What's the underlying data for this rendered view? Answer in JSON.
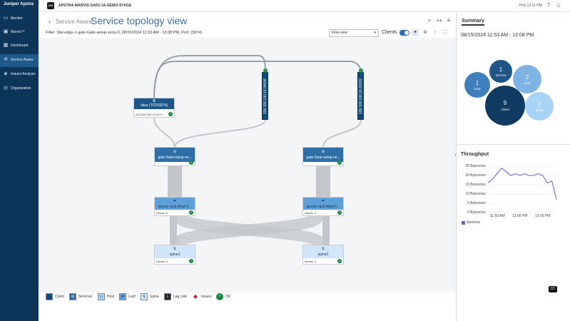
{
  "topbar": {
    "logo": "Juniper Apstra",
    "org_badge": "MM",
    "org_name": "APSTRA-MARVIS-SADC-IA-DEMO-STAGE",
    "time": "THU 12:11 PM"
  },
  "sidebar": {
    "items": [
      {
        "label": "Monitor",
        "icon": "monitor-icon"
      },
      {
        "label": "Marvis™",
        "icon": "marvis-icon"
      },
      {
        "label": "Dashboard",
        "icon": "dashboard-icon"
      },
      {
        "label": "Service Aware",
        "icon": "service-aware-icon",
        "active": true
      },
      {
        "label": "Impact Analysis",
        "icon": "impact-analysis-icon"
      },
      {
        "label": "Organization",
        "icon": "organization-icon"
      }
    ]
  },
  "header": {
    "breadcrumb": "Service Aware",
    "title": "Service topology view",
    "filter": "Filter: Site:edge-1-gate-Gate-setup-venu-0, 08/15/2024 11:53 AM - 12:08 PM, Port: (3074)"
  },
  "toolbar": {
    "view_select": "Flow view",
    "clients_label": "Clients",
    "clients_on": true
  },
  "topology": {
    "xbox": {
      "icon": "⌘",
      "label": "xbox (TCP/3074)",
      "address": "200.200.200.10:3074"
    },
    "links": [
      {
        "label": "100.100.100.16:34646"
      },
      {
        "label": "100.100.100.16:33192"
      }
    ],
    "services": [
      {
        "label": "gate-Gate-setup-ve..."
      },
      {
        "label": "gate-Gate-setup-ve..."
      }
    ],
    "leafs": [
      {
        "label": "vjunos-rack-4leaf-0...",
        "issues": "Issues: 0"
      },
      {
        "label": "vjunos-rack-4leaf-0...",
        "issues": "Issues: 0"
      }
    ],
    "spines": [
      {
        "label": "spine1",
        "issues": "Issues: 0"
      },
      {
        "label": "spine2",
        "issues": "Issues: 0"
      }
    ]
  },
  "legend": [
    {
      "label": "Client",
      "color": "#0f4a7a",
      "glyph": ""
    },
    {
      "label": "Services",
      "color": "#2f6fa7",
      "glyph": "⚙"
    },
    {
      "label": "Host",
      "color": "#a9d0f5",
      "glyph": "▭"
    },
    {
      "label": "Leaf",
      "color": "#5fa0d8",
      "glyph": "⇄"
    },
    {
      "label": "Spine",
      "color": "#cfe6fb",
      "glyph": "⇅"
    },
    {
      "label": "Lag Link",
      "color": "#222222",
      "glyph": "L"
    },
    {
      "label": "Issues",
      "color": "#c62828",
      "glyph": "◆"
    },
    {
      "label": "OK",
      "color": "#148a3c",
      "glyph": "✓"
    }
  ],
  "summary": {
    "tab": "Summary",
    "date_range": "08/15/2024 11:53 AM - 12:08 PM",
    "bubbles": [
      {
        "count": "1",
        "label": "Service",
        "color": "#1f5688"
      },
      {
        "count": "1",
        "label": "Host",
        "color": "#3f7fbc"
      },
      {
        "count": "2",
        "label": "Leaf",
        "color": "#7fb3e3"
      },
      {
        "count": "9",
        "label": "Client",
        "color": "#0f3a61"
      },
      {
        "count": "2",
        "label": "Spine",
        "color": "#a8d3f7"
      }
    ]
  },
  "throughput": {
    "title": "Throughput",
    "legend": "Services",
    "series_color": "#6a5acd"
  },
  "chart_data": {
    "type": "line",
    "title": "Throughput",
    "yticks": [
      "25 Bytes/sec",
      "20 Bytes/sec",
      "15 Bytes/sec",
      "10 Bytes/sec",
      "5 Bytes/sec",
      "0 Bytes/sec"
    ],
    "xticks": [
      "11:55 AM",
      "12:00 PM",
      "12:05 PM"
    ],
    "ylim": [
      0,
      25
    ],
    "x": [
      "11:52:30",
      "11:53:30",
      "11:54:30",
      "11:55:30",
      "11:56:30",
      "11:57:30",
      "11:58:30",
      "11:59:30",
      "12:00:30",
      "12:01:30",
      "12:02:30",
      "12:03:30",
      "12:04:30",
      "12:05:30",
      "12:06:30",
      "12:07:30"
    ],
    "series": [
      {
        "name": "Services",
        "values": [
          16,
          18,
          21,
          24,
          22,
          20,
          21,
          20,
          21,
          20,
          20,
          21,
          20,
          16,
          17,
          7
        ]
      }
    ]
  },
  "footer_badge": "CC"
}
